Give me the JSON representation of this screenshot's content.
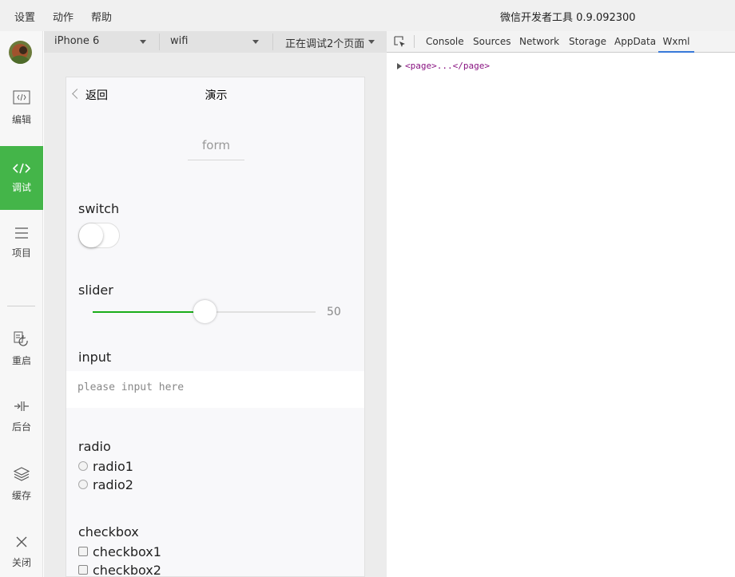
{
  "menubar": {
    "items": [
      "设置",
      "动作",
      "帮助"
    ],
    "app_title": "微信开发者工具 0.9.092300"
  },
  "sidebar": {
    "items": [
      {
        "label": "编辑",
        "icon": "code-file-icon"
      },
      {
        "label": "调试",
        "icon": "code-brackets-icon",
        "active": true
      },
      {
        "label": "项目",
        "icon": "menu-lines-icon"
      },
      {
        "label": "重启",
        "icon": "restart-icon"
      },
      {
        "label": "后台",
        "icon": "background-icon"
      },
      {
        "label": "缓存",
        "icon": "layers-icon"
      },
      {
        "label": "关闭",
        "icon": "close-icon"
      }
    ],
    "accent_color": "#44b549"
  },
  "sim_toolbar": {
    "device": "iPhone 6",
    "network": "wifi",
    "debug_status": "正在调试2个页面"
  },
  "phone": {
    "nav": {
      "back_label": "返回",
      "title": "演示"
    },
    "form_title": "form",
    "switch": {
      "label": "switch",
      "checked": false
    },
    "slider": {
      "label": "slider",
      "value": 50,
      "value_text": "50",
      "min": 0,
      "max": 100,
      "fill_color": "#1aad19"
    },
    "input": {
      "label": "input",
      "placeholder": "please input here",
      "value": ""
    },
    "radio": {
      "label": "radio",
      "options": [
        "radio1",
        "radio2"
      ]
    },
    "checkbox": {
      "label": "checkbox",
      "options": [
        "checkbox1",
        "checkbox2"
      ]
    }
  },
  "devtools": {
    "tabs": [
      "Console",
      "Sources",
      "Network",
      "Storage",
      "AppData",
      "Wxml"
    ],
    "active_tab": "Wxml",
    "dom_node": "<page>...</page>"
  }
}
